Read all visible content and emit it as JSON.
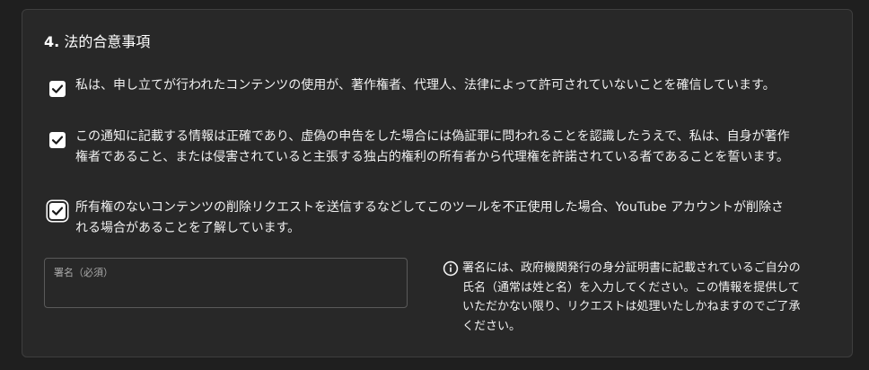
{
  "section": {
    "number": "4.",
    "title": "法的合意事項"
  },
  "agreements": [
    {
      "checked": true,
      "text": "私は、申し立てが行われたコンテンツの使用が、著作権者、代理人、法律によって許可されていないことを確信しています。"
    },
    {
      "checked": true,
      "text": "この通知に記載する情報は正確であり、虚偽の申告をした場合には偽証罪に問われることを認識したうえで、私は、自身が著作権者であること、または侵害されていると主張する独占的権利の所有者から代理権を許諾されている者であることを誓います。"
    },
    {
      "checked": true,
      "text": "所有権のないコンテンツの削除リクエストを送信するなどしてこのツールを不正使用した場合、YouTube アカウントが削除される場合があることを了解しています。"
    }
  ],
  "signature": {
    "label": "署名（必須）",
    "value": ""
  },
  "info": {
    "icon": "info-icon",
    "text": "署名には、政府機関発行の身分証明書に記載されているご自分の氏名（通常は姓と名）を入力してください。この情報を提供していただかない限り、リクエストは処理いたしかねますのでご了承ください。"
  },
  "colors": {
    "background": "#1f1f1f",
    "panel": "#282828",
    "checkbox": "#ffffff",
    "text": "#f1f1f1"
  }
}
